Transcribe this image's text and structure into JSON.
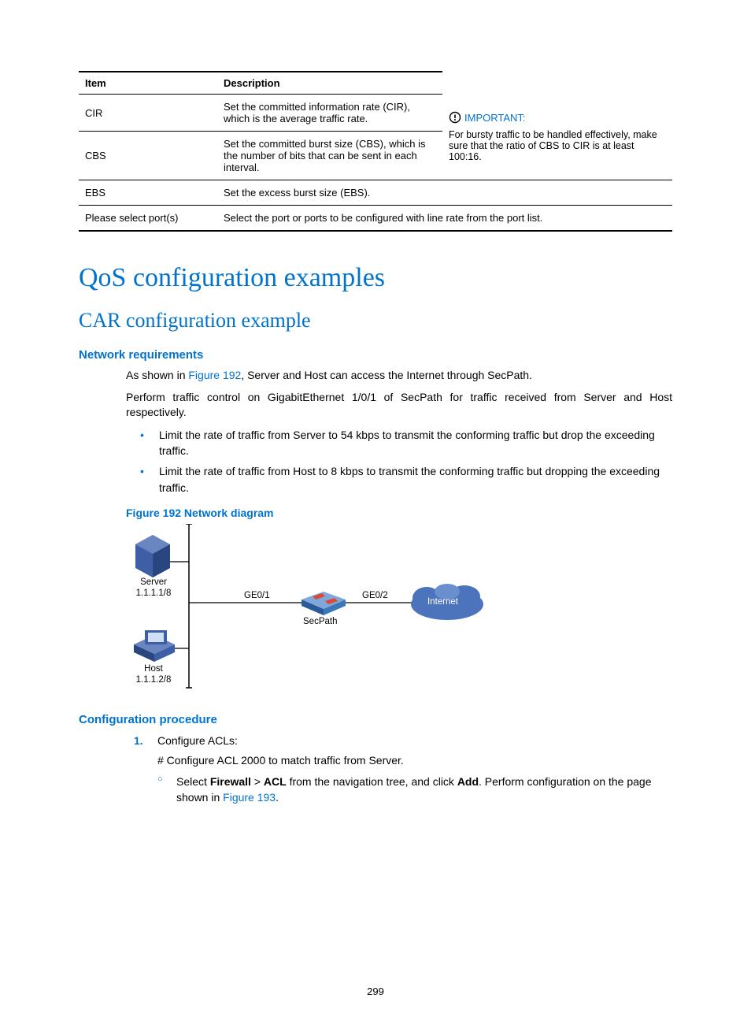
{
  "table": {
    "headers": [
      "Item",
      "Description"
    ],
    "rows": [
      {
        "item": "CIR",
        "desc": "Set the committed information rate (CIR), which is the average traffic rate."
      },
      {
        "item": "CBS",
        "desc": "Set the committed burst size (CBS), which is the number of bits that can be sent in each interval."
      },
      {
        "item": "EBS",
        "desc": "Set the excess burst size (EBS)."
      },
      {
        "item": "Please select port(s)",
        "desc": "Select the port or ports to be configured with line rate from the port list."
      }
    ],
    "important": {
      "label": "IMPORTANT:",
      "text": "For bursty traffic to be handled effectively, make sure that the ratio of CBS to CIR is at least 100:16."
    }
  },
  "h1": "QoS configuration examples",
  "h2": "CAR configuration example",
  "netreq_heading": "Network requirements",
  "p1_pre": "As shown in ",
  "p1_link": "Figure 192",
  "p1_post": ", Server and Host can access the Internet through SecPath.",
  "p2": "Perform traffic control on GigabitEthernet 1/0/1 of SecPath for traffic received from Server and Host respectively.",
  "bul1": "Limit the rate of traffic from Server to 54 kbps to transmit the conforming traffic but drop the exceeding traffic.",
  "bul2": "Limit the rate of traffic from Host to 8 kbps to transmit the conforming traffic but dropping the exceeding traffic.",
  "fig_caption": "Figure 192 Network diagram",
  "diagram": {
    "server": "Server",
    "server_ip": "1.1.1.1/8",
    "host": "Host",
    "host_ip": "1.1.1.2/8",
    "ge01": "GE0/1",
    "ge02": "GE0/2",
    "secpath": "SecPath",
    "internet": "Internet"
  },
  "confproc_heading": "Configuration procedure",
  "step1": "Configure ACLs:",
  "sub1": "# Configure ACL 2000 to match traffic from Server.",
  "circ1_a": "Select ",
  "circ1_b": "Firewall",
  "circ1_c": " > ",
  "circ1_d": "ACL",
  "circ1_e": " from the navigation tree, and click ",
  "circ1_f": "Add",
  "circ1_g": ". Perform configuration on the page shown in ",
  "circ1_link": "Figure 193",
  "circ1_h": ".",
  "page_number": "299"
}
